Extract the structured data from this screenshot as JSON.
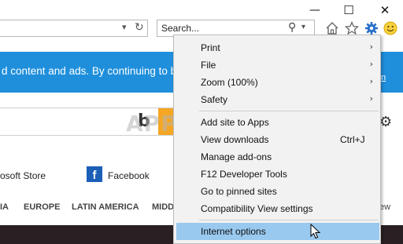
{
  "address_bar": {
    "dropdown_icon": "chevron-down-icon",
    "refresh_icon": "refresh-icon"
  },
  "search": {
    "placeholder": "Search..."
  },
  "window": {
    "minimize_glyph": "—",
    "maximize_glyph": "☐",
    "close_glyph": "✕"
  },
  "toolbar": {
    "icons": [
      "home-icon",
      "favorites-star-icon",
      "tools-gear-icon",
      "smiley-feedback-icon"
    ],
    "accent": "#2a6fc9"
  },
  "page": {
    "banner_text": "d content and ads. By continuing to bro",
    "banner_right": "n",
    "banner_color": "#1f8fdc",
    "bing_logo": "b",
    "watermark": "APPUALS",
    "ms_store": "osoft Store",
    "facebook": "Facebook",
    "regions": [
      "IA",
      "EUROPE",
      "LATIN AMERICA",
      "MIDD"
    ],
    "region_right": "ew"
  },
  "menu": {
    "items": [
      {
        "label": "Print",
        "has_submenu": true
      },
      {
        "label": "File",
        "has_submenu": true
      },
      {
        "label": "Zoom (100%)",
        "has_submenu": true
      },
      {
        "label": "Safety",
        "has_submenu": true
      },
      {
        "label": "Add site to Apps"
      },
      {
        "label": "View downloads",
        "shortcut": "Ctrl+J"
      },
      {
        "label": "Manage add-ons"
      },
      {
        "label": "F12 Developer Tools"
      },
      {
        "label": "Go to pinned sites"
      },
      {
        "label": "Compatibility View settings"
      },
      {
        "label": "Internet options",
        "highlighted": true
      }
    ],
    "submenu_glyph": "›",
    "highlight_color": "#99c9ef"
  }
}
